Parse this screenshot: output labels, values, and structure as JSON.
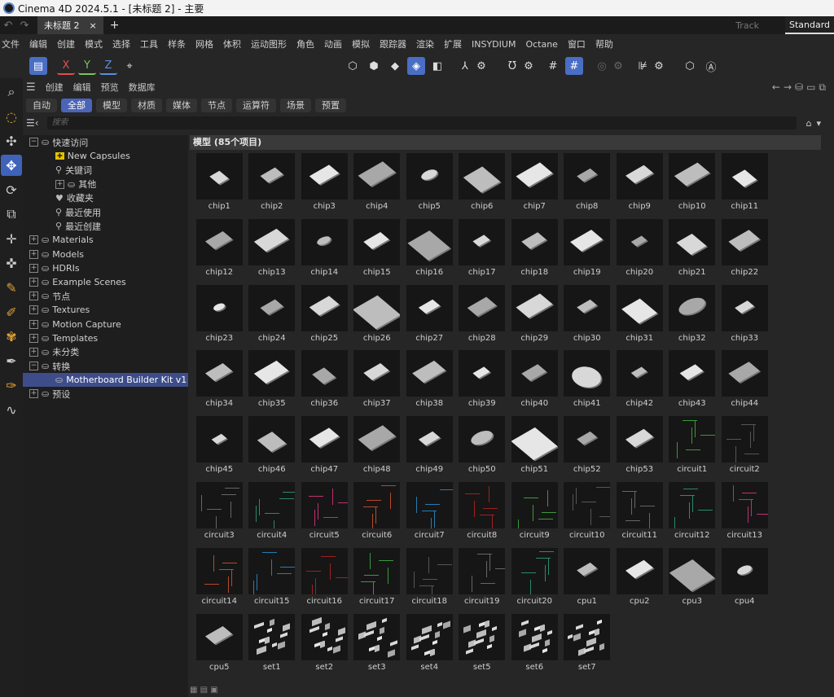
{
  "window": {
    "title": "Cinema 4D 2024.5.1 - [未标题 2] - 主要"
  },
  "tabs": {
    "back": "↶",
    "forward": "↷",
    "doc": "未标题 2",
    "close": "×",
    "plus": "+",
    "track": "Track",
    "standard": "Standard"
  },
  "menu": [
    "文件",
    "编辑",
    "创建",
    "模式",
    "选择",
    "工具",
    "样条",
    "网格",
    "体积",
    "运动图形",
    "角色",
    "动画",
    "模拟",
    "跟踪器",
    "渲染",
    "扩展",
    "INSYDIUM",
    "Octane",
    "窗口",
    "帮助"
  ],
  "axis": {
    "x": "X",
    "y": "Y",
    "z": "Z"
  },
  "panel_menu": {
    "create": "创建",
    "edit": "编辑",
    "preview": "预览",
    "database": "数据库"
  },
  "filters": [
    "自动",
    "全部",
    "模型",
    "材质",
    "媒体",
    "节点",
    "运算符",
    "场景",
    "预置"
  ],
  "search": {
    "placeholder": "搜索"
  },
  "tree": [
    {
      "l": "快速访问",
      "d": 0,
      "t": "folder",
      "pm": "−"
    },
    {
      "l": "New Capsules",
      "d": 1,
      "t": "capsule"
    },
    {
      "l": "关键词",
      "d": 1,
      "t": "search"
    },
    {
      "l": "其他",
      "d": 1,
      "t": "folder",
      "pm": "+"
    },
    {
      "l": "收藏夹",
      "d": 1,
      "t": "heart"
    },
    {
      "l": "最近使用",
      "d": 1,
      "t": "search"
    },
    {
      "l": "最近创建",
      "d": 1,
      "t": "search"
    },
    {
      "l": "Materials",
      "d": 0,
      "t": "folder",
      "pm": "+"
    },
    {
      "l": "Models",
      "d": 0,
      "t": "folder",
      "pm": "+"
    },
    {
      "l": "HDRIs",
      "d": 0,
      "t": "folder",
      "pm": "+"
    },
    {
      "l": "Example Scenes",
      "d": 0,
      "t": "folder",
      "pm": "+"
    },
    {
      "l": "节点",
      "d": 0,
      "t": "folder",
      "pm": "+"
    },
    {
      "l": "Textures",
      "d": 0,
      "t": "folder",
      "pm": "+"
    },
    {
      "l": "Motion Capture",
      "d": 0,
      "t": "folder",
      "pm": "+"
    },
    {
      "l": "Templates",
      "d": 0,
      "t": "folder",
      "pm": "+"
    },
    {
      "l": "未分类",
      "d": 0,
      "t": "folder",
      "pm": "+"
    },
    {
      "l": "转换",
      "d": 0,
      "t": "folder",
      "pm": "−"
    },
    {
      "l": "Motherboard Builder Kit v1",
      "d": 1,
      "t": "folder",
      "sel": true
    },
    {
      "l": "预设",
      "d": 0,
      "t": "folder",
      "pm": "+"
    }
  ],
  "grid": {
    "header": "模型 (85个项目)",
    "items": [
      "chip1",
      "chip2",
      "chip3",
      "chip4",
      "chip5",
      "chip6",
      "chip7",
      "chip8",
      "chip9",
      "chip10",
      "chip11",
      "chip12",
      "chip13",
      "chip14",
      "chip15",
      "chip16",
      "chip17",
      "chip18",
      "chip19",
      "chip20",
      "chip21",
      "chip22",
      "chip23",
      "chip24",
      "chip25",
      "chip26",
      "chip27",
      "chip28",
      "chip29",
      "chip30",
      "chip31",
      "chip32",
      "chip33",
      "chip34",
      "chip35",
      "chip36",
      "chip37",
      "chip38",
      "chip39",
      "chip40",
      "chip41",
      "chip42",
      "chip43",
      "chip44",
      "chip45",
      "chip46",
      "chip47",
      "chip48",
      "chip49",
      "chip50",
      "chip51",
      "chip52",
      "chip53",
      "circuit1",
      "circuit2",
      "circuit3",
      "circuit4",
      "circuit5",
      "circuit6",
      "circuit7",
      "circuit8",
      "circuit9",
      "circuit10",
      "circuit11",
      "circuit12",
      "circuit13",
      "circuit14",
      "circuit15",
      "circuit16",
      "circuit17",
      "circuit18",
      "circuit19",
      "circuit20",
      "cpu1",
      "cpu2",
      "cpu3",
      "cpu4",
      "cpu5",
      "set1",
      "set2",
      "set3",
      "set4",
      "set5",
      "set6",
      "set7"
    ]
  }
}
